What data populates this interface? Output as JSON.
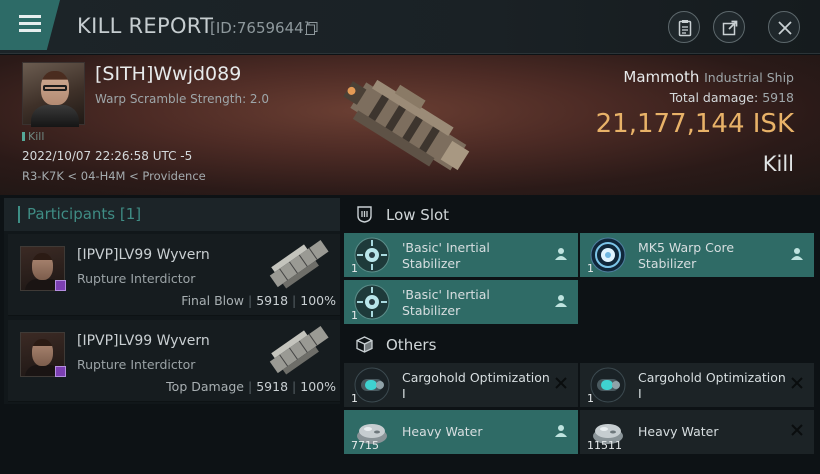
{
  "window": {
    "title": "KILL REPORT",
    "report_id": "[ID:7659644]",
    "buttons": {
      "menu": "menu-icon",
      "clipboard": "clipboard-icon",
      "external": "external-link-icon",
      "close": "close-icon"
    }
  },
  "victim": {
    "name": "[SITH]Wwjd089",
    "warp_scramble": "Warp Scramble Strength: 2.0",
    "kill_tag": "Kill",
    "datetime": "2022/10/07 22:26:58 UTC -5",
    "location": "R3-K7K < 04-H4M < Providence",
    "ship_name": "Mammoth",
    "ship_class": "Industrial Ship",
    "total_damage_label": "Total damage:",
    "total_damage": "5918",
    "isk_value": "21,177,144",
    "isk_unit": "ISK",
    "result": "Kill"
  },
  "participants": {
    "header": "Participants",
    "count": "[1]",
    "rows": [
      {
        "name": "[IPVP]LV99 Wyvern",
        "ship": "Rupture Interdictor",
        "role": "Final Blow",
        "damage": "5918",
        "percent": "100%"
      },
      {
        "name": "[IPVP]LV99 Wyvern",
        "ship": "Rupture Interdictor",
        "role": "Top Damage",
        "damage": "5918",
        "percent": "100%"
      }
    ]
  },
  "fitting": {
    "low_slot": {
      "label": "Low Slot",
      "items": [
        {
          "name": "'Basic' Inertial Stabilizer",
          "qty": "1",
          "status": "pilot"
        },
        {
          "name": "MK5 Warp Core Stabilizer",
          "qty": "1",
          "status": "pilot"
        },
        {
          "name": "'Basic' Inertial Stabilizer",
          "qty": "1",
          "status": "pilot"
        }
      ]
    },
    "others": {
      "label": "Others",
      "items": [
        {
          "name": "Cargohold Optimization I",
          "qty": "1",
          "status": "destroyed"
        },
        {
          "name": "Cargohold Optimization I",
          "qty": "1",
          "status": "destroyed"
        },
        {
          "name": "Heavy Water",
          "qty": "7715",
          "status": "pilot"
        },
        {
          "name": "Heavy Water",
          "qty": "11511",
          "status": "destroyed"
        }
      ]
    }
  },
  "colors": {
    "accent_teal": "#2f6b66",
    "isk_gold": "#e8b268",
    "badge_purple": "#7c3fb2"
  }
}
